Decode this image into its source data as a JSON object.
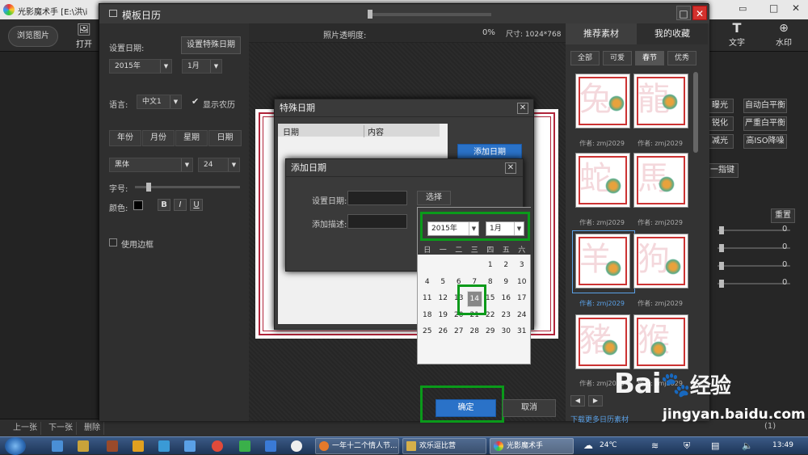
{
  "app": {
    "title": "光影魔术手  [E:\\洪\\i",
    "browse_button": "浏览图片",
    "open_label": "打开",
    "text_tool": "文字",
    "watermark_tool": "水印",
    "right_buttons": [
      "曝光",
      "自动白平衡",
      "锐化",
      "严重白平衡",
      "减光",
      "高ISO降噪"
    ],
    "one_click": "一指键",
    "reset": "重置",
    "slider_values": [
      "0",
      "0",
      "0",
      "0"
    ],
    "bottom_buttons": [
      "上一张",
      "下一张",
      "删除"
    ],
    "bottom_right": "(1)"
  },
  "window": {
    "title": "模板日历",
    "min_label": "□",
    "close_label": "✕"
  },
  "left_panel": {
    "set_date_label": "设置日期:",
    "special_date_button": "设置特殊日期",
    "year_value": "2015年",
    "month_value": "1月",
    "language_label": "语言:",
    "language_value": "中文1",
    "lunar_label": "显示农历",
    "tabs": [
      "年份",
      "月份",
      "星期",
      "日期"
    ],
    "font_value": "黑体",
    "size_value": "24",
    "font_size_label": "字号:",
    "color_label": "颜色:",
    "style_buttons": [
      "B",
      "I",
      "U"
    ],
    "border_label": "使用边框"
  },
  "topbar": {
    "opacity_label": "照片透明度:",
    "opacity_value": "0%",
    "size_label": "尺寸: 1024*768"
  },
  "right_panel": {
    "tabs": [
      "推荐素材",
      "我的收藏"
    ],
    "categories": [
      "全部",
      "可爱",
      "春节",
      "优秀"
    ],
    "thumbs": [
      {
        "char": "兔",
        "author": "作者: zmj2029"
      },
      {
        "char": "龍",
        "author": "作者: zmj2029"
      },
      {
        "char": "蛇",
        "author": "作者: zmj2029"
      },
      {
        "char": "馬",
        "author": "作者: zmj2029"
      },
      {
        "char": "羊",
        "author": "作者: zmj2029"
      },
      {
        "char": "狗",
        "author": "作者: zmj2029"
      },
      {
        "char": "豬",
        "author": "作者: zmj2029"
      },
      {
        "char": "猴",
        "author": "作者: zmj2029"
      }
    ],
    "more_link": "下载更多日历素材"
  },
  "special_dialog": {
    "title": "特殊日期",
    "col_date": "日期",
    "col_content": "内容",
    "add_button": "添加日期"
  },
  "add_dialog": {
    "title": "添加日期",
    "set_date_label": "设置日期:",
    "desc_label": "添加描述:",
    "choose_button": "选择"
  },
  "calendar": {
    "year": "2015年",
    "month": "1月",
    "weekdays": [
      "日",
      "一",
      "二",
      "三",
      "四",
      "五",
      "六"
    ],
    "selected_day": "14",
    "rows": [
      [
        "",
        "",
        "",
        "",
        "1",
        "2",
        "3"
      ],
      [
        "4",
        "5",
        "6",
        "7",
        "8",
        "9",
        "10"
      ],
      [
        "11",
        "12",
        "13",
        "14",
        "15",
        "16",
        "17"
      ],
      [
        "18",
        "19",
        "20",
        "21",
        "22",
        "23",
        "24"
      ],
      [
        "25",
        "26",
        "27",
        "28",
        "29",
        "30",
        "31"
      ]
    ]
  },
  "footer": {
    "ok": "确定",
    "cancel": "取消"
  },
  "taskbar": {
    "tasks": [
      "一年十二个情人节...",
      "欢乐逗比营",
      "光影魔术手"
    ],
    "temperature": "24℃",
    "time": "13:49"
  },
  "watermark": {
    "brand": "Bai",
    "brand2": "经验",
    "url": "jingyan.baidu.com"
  },
  "colors": {
    "accent": "#2a72c8",
    "highlight": "#0a9a1a",
    "frame": "#b0243a"
  }
}
